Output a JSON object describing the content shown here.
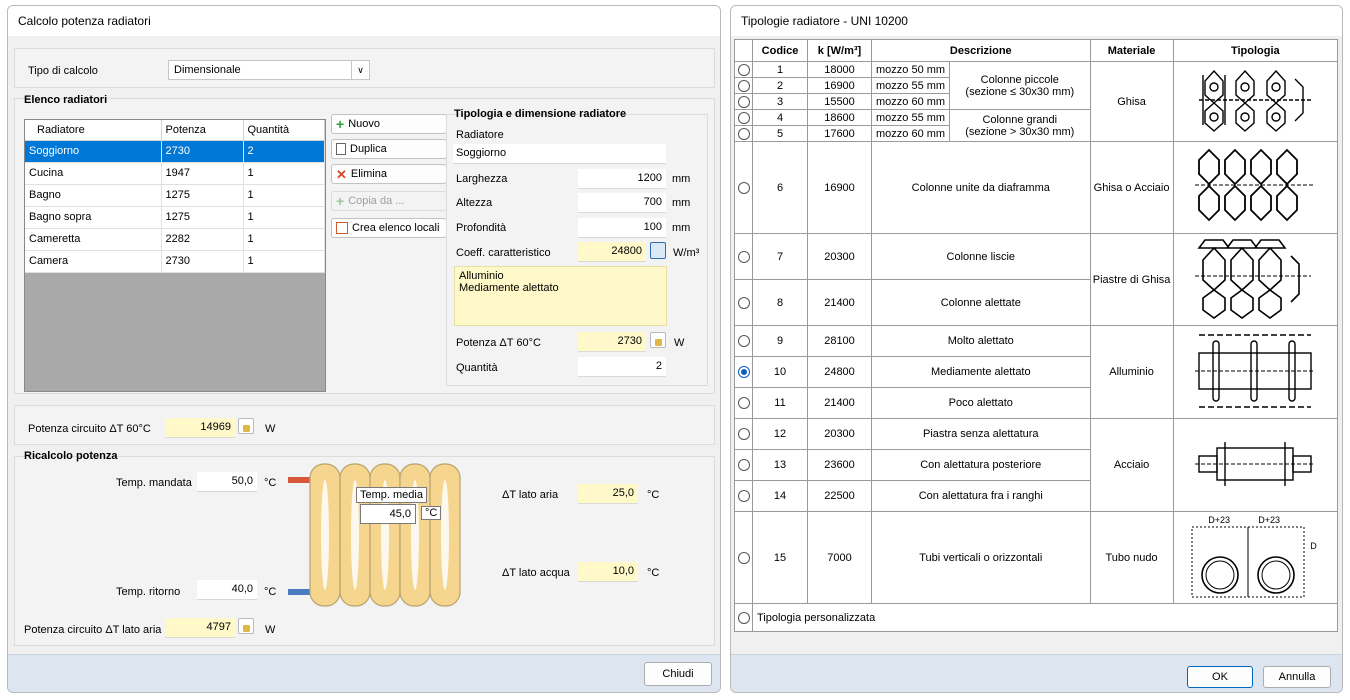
{
  "left_window": {
    "title": "Calcolo potenza radiatori",
    "tipo_calcolo_label": "Tipo di calcolo",
    "tipo_calcolo_value": "Dimensionale",
    "elenco_title": "Elenco radiatori",
    "columns": [
      "Radiatore",
      "Potenza",
      "Quantità"
    ],
    "rows": [
      {
        "name": "Soggiorno",
        "power": "2730",
        "qty": "2"
      },
      {
        "name": "Cucina",
        "power": "1947",
        "qty": "1"
      },
      {
        "name": "Bagno",
        "power": "1275",
        "qty": "1"
      },
      {
        "name": "Bagno sopra",
        "power": "1275",
        "qty": "1"
      },
      {
        "name": "Cameretta",
        "power": "2282",
        "qty": "1"
      },
      {
        "name": "Camera",
        "power": "2730",
        "qty": "1"
      }
    ],
    "buttons": {
      "nuovo": "Nuovo",
      "duplica": "Duplica",
      "elimina": "Elimina",
      "copia": "Copia da ...",
      "crea": "Crea elenco locali",
      "chiudi": "Chiudi"
    },
    "tipologia_title": "Tipologia e dimensione radiatore",
    "radiatore_label": "Radiatore",
    "radiatore_value": "Soggiorno",
    "larghezza_label": "Larghezza",
    "larghezza_value": "1200",
    "altezza_label": "Altezza",
    "altezza_value": "700",
    "profondita_label": "Profondità",
    "profondita_value": "100",
    "unit_mm": "mm",
    "coeff_label": "Coeff. caratteristico",
    "coeff_value": "24800",
    "coeff_unit": "W/m³",
    "note_line1": "Alluminio",
    "note_line2": "Mediamente alettato",
    "potenza_label": "Potenza ΔT 60°C",
    "potenza_value": "2730",
    "unit_w": "W",
    "quantita_label": "Quantità",
    "quantita_value": "2",
    "circuito_label": "Potenza circuito ΔT 60°C",
    "circuito_value": "14969",
    "ricalcolo_title": "Ricalcolo potenza",
    "mandata_label": "Temp. mandata",
    "mandata_value": "50,0",
    "ritorno_label": "Temp. ritorno",
    "ritorno_value": "40,0",
    "unit_c": "°C",
    "media_label": "Temp. media",
    "media_value": "45,0",
    "dt_aria_label": "ΔT lato aria",
    "dt_aria_value": "25,0",
    "dt_acqua_label": "ΔT lato acqua",
    "dt_acqua_value": "10,0",
    "circuito_aria_label": "Potenza circuito ΔT lato aria",
    "circuito_aria_value": "4797"
  },
  "right_window": {
    "title": "Tipologie radiatore - UNI 10200",
    "headers": [
      "Codice",
      "k [W/m³]",
      "Descrizione",
      "Materiale",
      "Tipologia"
    ],
    "g1": [
      {
        "code": "1",
        "k": "18000",
        "hub": "mozzo 50 mm"
      },
      {
        "code": "2",
        "k": "16900",
        "hub": "mozzo 55 mm"
      },
      {
        "code": "3",
        "k": "15500",
        "hub": "mozzo 60 mm"
      },
      {
        "code": "4",
        "k": "18600",
        "hub": "mozzo 55 mm"
      },
      {
        "code": "5",
        "k": "17600",
        "hub": "mozzo 60 mm"
      }
    ],
    "colonne_piccole": "Colonne piccole",
    "sezione_piccole": "(sezione ≤ 30x30 mm)",
    "colonne_grandi": "Colonne grandi",
    "sezione_grandi": "(sezione > 30x30 mm)",
    "ghisa": "Ghisa",
    "r6": {
      "code": "6",
      "k": "16900",
      "desc": "Colonne unite da diaframma",
      "mat": "Ghisa o Acciaio"
    },
    "r7": {
      "code": "7",
      "k": "20300",
      "desc": "Colonne liscie"
    },
    "r8": {
      "code": "8",
      "k": "21400",
      "desc": "Colonne alettate"
    },
    "piastre": "Piastre di Ghisa",
    "r9": {
      "code": "9",
      "k": "28100",
      "desc": "Molto alettato"
    },
    "r10": {
      "code": "10",
      "k": "24800",
      "desc": "Mediamente alettato"
    },
    "r11": {
      "code": "11",
      "k": "21400",
      "desc": "Poco alettato"
    },
    "alluminio": "Alluminio",
    "r12": {
      "code": "12",
      "k": "20300",
      "desc": "Piastra senza alettatura"
    },
    "r13": {
      "code": "13",
      "k": "23600",
      "desc": "Con alettatura posteriore"
    },
    "r14": {
      "code": "14",
      "k": "22500",
      "desc": "Con alettatura fra i ranghi"
    },
    "acciaio": "Acciaio",
    "r15": {
      "code": "15",
      "k": "7000",
      "desc": "Tubi verticali o orizzontali",
      "mat": "Tubo nudo"
    },
    "dim1": "D+23",
    "dim2": "D+23",
    "dimD": "D",
    "custom": "Tipologia personalizzata",
    "ok": "OK",
    "annulla": "Annulla"
  }
}
